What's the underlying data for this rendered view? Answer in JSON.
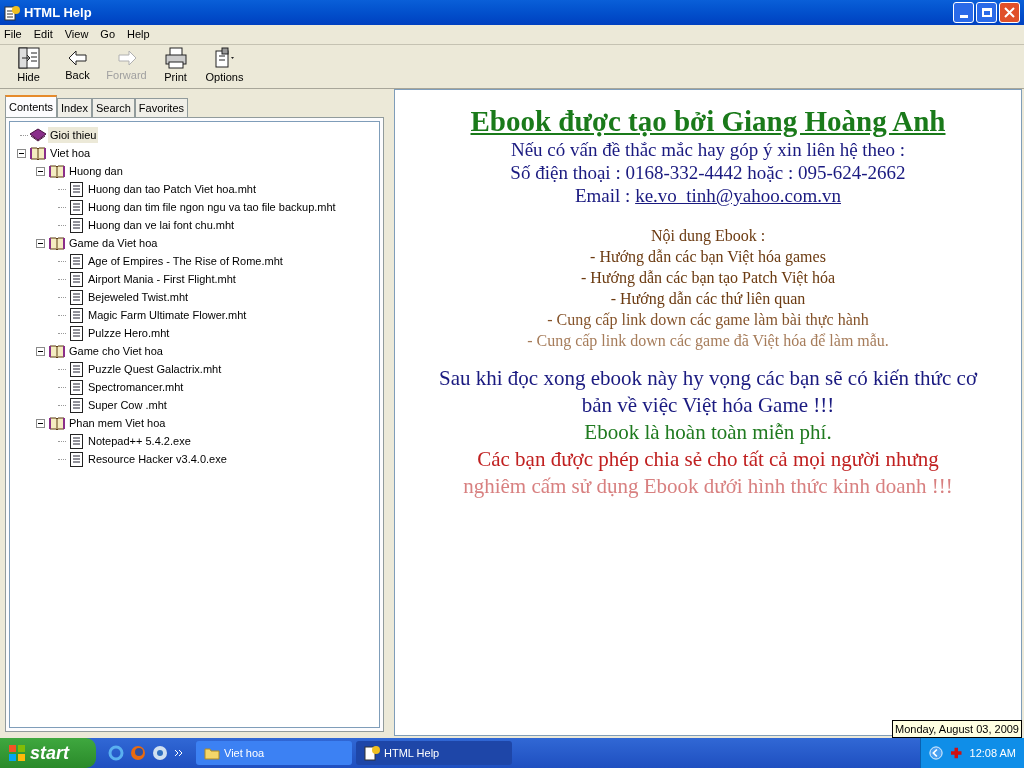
{
  "window": {
    "title": "HTML Help"
  },
  "menu": [
    "File",
    "Edit",
    "View",
    "Go",
    "Help"
  ],
  "toolbar": [
    {
      "label": "Hide",
      "kind": "hide",
      "disabled": false
    },
    {
      "label": "Back",
      "kind": "back",
      "disabled": false
    },
    {
      "label": "Forward",
      "kind": "forward",
      "disabled": true
    },
    {
      "label": "Print",
      "kind": "print",
      "disabled": false
    },
    {
      "label": "Options",
      "kind": "options",
      "disabled": false
    }
  ],
  "tabs": [
    {
      "label": "Contents",
      "selected": true
    },
    {
      "label": "Index",
      "selected": false
    },
    {
      "label": "Search",
      "selected": false
    },
    {
      "label": "Favorites",
      "selected": false
    }
  ],
  "tree": [
    {
      "label": "Gioi thieu",
      "kind": "book",
      "expanded": false,
      "selected": true
    },
    {
      "label": "Viet hoa",
      "kind": "book",
      "expanded": true,
      "selected": false,
      "children": [
        {
          "label": "Huong dan",
          "kind": "book",
          "expanded": true,
          "selected": false,
          "children": [
            {
              "label": "Huong dan tao Patch Viet hoa.mht",
              "kind": "page",
              "selected": false
            },
            {
              "label": "Huong dan tim file ngon ngu va tao file backup.mht",
              "kind": "page",
              "selected": false
            },
            {
              "label": "Huong dan ve lai font chu.mht",
              "kind": "page",
              "selected": false
            }
          ]
        },
        {
          "label": "Game da Viet hoa",
          "kind": "book",
          "expanded": true,
          "selected": false,
          "children": [
            {
              "label": "Age of Empires - The Rise of Rome.mht",
              "kind": "page",
              "selected": false
            },
            {
              "label": "Airport Mania - First Flight.mht",
              "kind": "page",
              "selected": false
            },
            {
              "label": "Bejeweled Twist.mht",
              "kind": "page",
              "selected": false
            },
            {
              "label": "Magic Farm Ultimate Flower.mht",
              "kind": "page",
              "selected": false
            },
            {
              "label": "Pulzze Hero.mht",
              "kind": "page",
              "selected": false
            }
          ]
        },
        {
          "label": "Game cho Viet hoa",
          "kind": "book",
          "expanded": true,
          "selected": false,
          "children": [
            {
              "label": "Puzzle Quest Galactrix.mht",
              "kind": "page",
              "selected": false
            },
            {
              "label": "Spectromancer.mht",
              "kind": "page",
              "selected": false
            },
            {
              "label": "Super Cow .mht",
              "kind": "page",
              "selected": false
            }
          ]
        },
        {
          "label": "Phan mem Viet hoa",
          "kind": "book",
          "expanded": true,
          "selected": false,
          "children": [
            {
              "label": "Notepad++  5.4.2.exe",
              "kind": "page",
              "selected": false
            },
            {
              "label": "Resource Hacker v3.4.0.exe",
              "kind": "page",
              "selected": false
            }
          ]
        }
      ]
    }
  ],
  "content": {
    "title": "Ebook được tạo bởi Giang Hoàng Anh",
    "contact": [
      "Nếu có vấn đề thắc mắc hay góp ý xin liên hệ theo :",
      "Số điện thoại : 0168-332-4442 hoặc : 095-624-2662"
    ],
    "email_label": "Email : ",
    "email": "ke.vo_tinh@yahoo.com.vn",
    "summary": [
      {
        "text": "Nội dung Ebook :",
        "color": "#6b3a10"
      },
      {
        "text": "- Hướng dẫn các bạn Việt hóa games",
        "color": "#6b3a10"
      },
      {
        "text": "- Hướng dẫn các bạn tạo Patch Việt hóa",
        "color": "#6b3a10"
      },
      {
        "text": "- Hướng dẫn các thứ liên quan",
        "color": "#6b3a10"
      },
      {
        "text": "- Cung cấp link down các game làm bài thực hành",
        "color": "#85532a"
      },
      {
        "text": "- Cung cấp link down các game đã Việt hóa để làm mẫu.",
        "color": "#a67c5a"
      }
    ],
    "notes": [
      {
        "text": "Sau khi đọc xong ebook này hy vọng các bạn sẽ có kiến thức cơ bản về việc Việt hóa Game !!!",
        "color": "#1a1a80"
      },
      {
        "text": "Ebook là hoàn toàn miễn phí.",
        "color": "#1f7a1f"
      },
      {
        "text": "Các bạn được phép chia sẻ cho tất cả mọi người nhưng",
        "color": "#c02020"
      },
      {
        "text": "nghiêm cấm sử dụng Ebook dưới hình thức kinh doanh !!!",
        "color": "#d88080"
      }
    ]
  },
  "taskbar": {
    "start": "start",
    "tasks": [
      {
        "label": "Viet hoa",
        "kind": "folder",
        "selected": false
      },
      {
        "label": "HTML Help",
        "kind": "help",
        "selected": true
      }
    ],
    "clock": "12:08 AM",
    "tooltip": "Monday, August 03, 2009"
  }
}
